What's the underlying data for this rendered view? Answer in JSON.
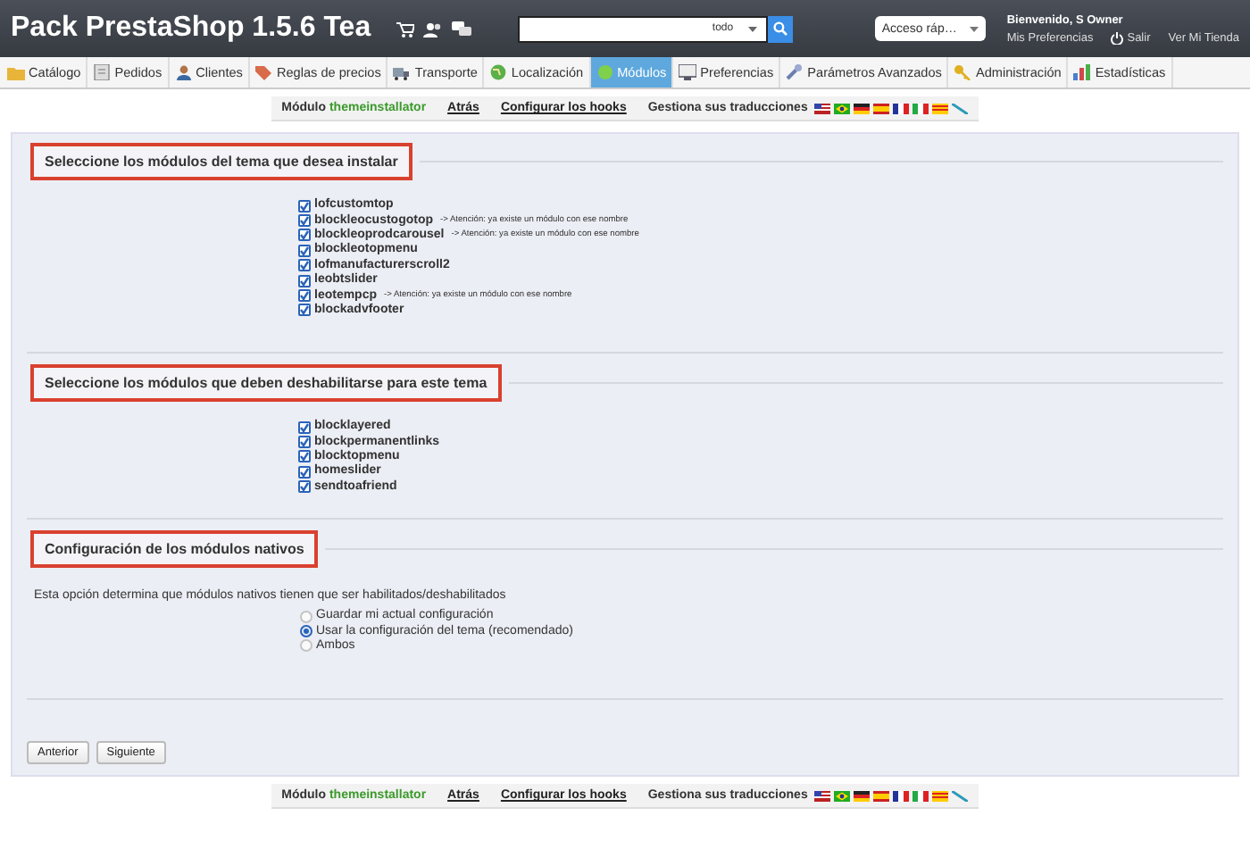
{
  "header": {
    "title": "Pack PrestaShop 1.5.6 Tea",
    "search_filter": "todo",
    "quick_access": "Acceso ráp…",
    "greeting": "Bienvenido, S Owner",
    "links": [
      {
        "kind": "prefs",
        "label": "Mis Preferencias"
      },
      {
        "kind": "logout",
        "label": "Salir"
      },
      {
        "kind": "shop",
        "label": "Ver Mi Tienda"
      }
    ]
  },
  "tabs": [
    {
      "label": "Catálogo",
      "selected": false
    },
    {
      "label": "Pedidos",
      "selected": false
    },
    {
      "label": "Clientes",
      "selected": false
    },
    {
      "label": "Reglas de precios",
      "selected": false
    },
    {
      "label": "Transporte",
      "selected": false
    },
    {
      "label": "Localización",
      "selected": false
    },
    {
      "label": "Módulos",
      "selected": true
    },
    {
      "label": "Preferencias",
      "selected": false
    },
    {
      "label": "Parámetros Avanzados",
      "selected": false
    },
    {
      "label": "Administración",
      "selected": false
    },
    {
      "label": "Estadísticas",
      "selected": false
    }
  ],
  "toolbar_top": {
    "module_label": "Módulo",
    "module_name": "themeinstallator",
    "back": "Atrás",
    "hooks": "Configurar los hooks",
    "translations": "Gestiona sus traducciones"
  },
  "sections": [
    {
      "kind": "checklist",
      "legend": "Seleccione los módulos del tema que desea instalar",
      "items": [
        {
          "name": "lofcustomtop",
          "checked": true
        },
        {
          "name": "blockleocustogotop",
          "checked": true,
          "note": "-> Atención: ya existe un módulo con ese nombre"
        },
        {
          "name": "blockleoprodcarousel",
          "checked": true,
          "note": "-> Atención: ya existe un módulo con ese nombre"
        },
        {
          "name": "blockleotopmenu",
          "checked": true
        },
        {
          "name": "lofmanufacturerscroll2",
          "checked": true
        },
        {
          "name": "leobtslider",
          "checked": true
        },
        {
          "name": "leotempcp",
          "checked": true,
          "note": "-> Atención: ya existe un módulo con ese nombre"
        },
        {
          "name": "blockadvfooter",
          "checked": true
        }
      ]
    },
    {
      "kind": "checklist",
      "legend": "Seleccione los módulos que deben deshabilitarse para este tema",
      "items": [
        {
          "name": "blocklayered",
          "checked": true
        },
        {
          "name": "blockpermanentlinks",
          "checked": true
        },
        {
          "name": "blocktopmenu",
          "checked": true
        },
        {
          "name": "homeslider",
          "checked": true
        },
        {
          "name": "sendtoafriend",
          "checked": true
        }
      ]
    },
    {
      "kind": "radios",
      "legend": "Configuración de los módulos nativos",
      "description": "Esta opción determina que módulos nativos tienen que ser habilitados/deshabilitados",
      "options": [
        {
          "label": "Guardar mi actual configuración",
          "selected": false
        },
        {
          "label": "Usar la configuración del tema (recomendado)",
          "selected": true
        },
        {
          "label": "Ambos",
          "selected": false
        }
      ]
    }
  ],
  "buttons": [
    "Anterior",
    "Siguiente"
  ],
  "toolbar_bottom": {
    "module_label": "Módulo",
    "module_name": "themeinstallator",
    "back": "Atrás",
    "hooks": "Configurar los hooks",
    "translations": "Gestiona sus traducciones"
  }
}
